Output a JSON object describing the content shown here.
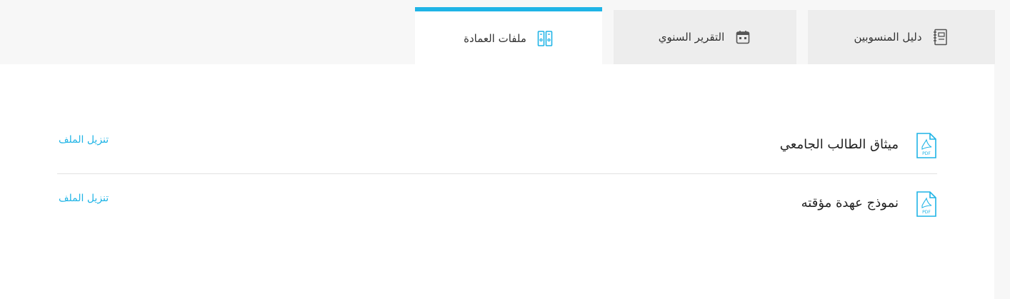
{
  "tabs": [
    {
      "label": "دليل المنسوبين",
      "icon": "notebook-icon",
      "active": false
    },
    {
      "label": "التقرير السنوي",
      "icon": "calendar-icon",
      "active": false
    },
    {
      "label": "ملفات العمادة",
      "icon": "binders-icon",
      "active": true
    }
  ],
  "files": [
    {
      "name": "ميثاق الطالب الجامعي",
      "icon": "pdf-file-icon",
      "pdf_badge": "PDF",
      "download_label": "تنزيل الملف"
    },
    {
      "name": "نموذج عهدة مؤقته",
      "icon": "pdf-file-icon",
      "pdf_badge": "PDF",
      "download_label": "تنزيل الملف"
    }
  ],
  "colors": {
    "accent": "#1fb4e6",
    "tab_inactive": "#ededed",
    "panel": "#ffffff",
    "divider": "#e2e2e2"
  }
}
